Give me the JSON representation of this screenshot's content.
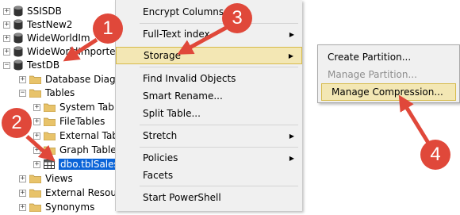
{
  "tree": {
    "items": [
      {
        "expander": "+",
        "icon": "database-icon",
        "label": "SSISDB"
      },
      {
        "expander": "+",
        "icon": "database-icon",
        "label": "TestNew2"
      },
      {
        "expander": "+",
        "icon": "database-icon",
        "label": "WideWorldIm"
      },
      {
        "expander": "+",
        "icon": "database-icon",
        "label": "WideWorldImporte"
      },
      {
        "expander": "−",
        "icon": "database-icon",
        "label": "TestDB"
      },
      {
        "expander": "+",
        "icon": "folder-icon",
        "label": "Database Diagra"
      },
      {
        "expander": "−",
        "icon": "folder-icon",
        "label": "Tables"
      },
      {
        "expander": "+",
        "icon": "folder-icon",
        "label": "System Tabl"
      },
      {
        "expander": "+",
        "icon": "folder-icon",
        "label": "FileTables"
      },
      {
        "expander": "+",
        "icon": "folder-icon",
        "label": "External Tabl"
      },
      {
        "expander": "+",
        "icon": "folder-icon",
        "label": "Graph Table"
      },
      {
        "expander": "+",
        "icon": "table-icon",
        "label": "dbo.tblSales"
      },
      {
        "expander": "+",
        "icon": "folder-icon",
        "label": "Views"
      },
      {
        "expander": "+",
        "icon": "folder-icon",
        "label": "External Resourc"
      },
      {
        "expander": "+",
        "icon": "folder-icon",
        "label": "Synonyms"
      }
    ]
  },
  "context_menu": {
    "items": [
      {
        "label": "Encrypt Columns..."
      },
      {
        "label": "Full-Text index"
      },
      {
        "label": "Storage"
      },
      {
        "label": "Find Invalid Objects"
      },
      {
        "label": "Smart Rename..."
      },
      {
        "label": "Split Table..."
      },
      {
        "label": "Stretch"
      },
      {
        "label": "Policies"
      },
      {
        "label": "Facets"
      },
      {
        "label": "Start PowerShell"
      }
    ]
  },
  "storage_submenu": {
    "items": [
      {
        "label": "Create Partition..."
      },
      {
        "label": "Manage Partition..."
      },
      {
        "label": "Manage Compression..."
      }
    ]
  },
  "callouts": [
    "1",
    "2",
    "3",
    "4"
  ],
  "colors": {
    "callout": "#e0483a",
    "selection": "#0a64d8",
    "menu_highlight": "#f3e7b4",
    "folder": "#e8c36a"
  }
}
